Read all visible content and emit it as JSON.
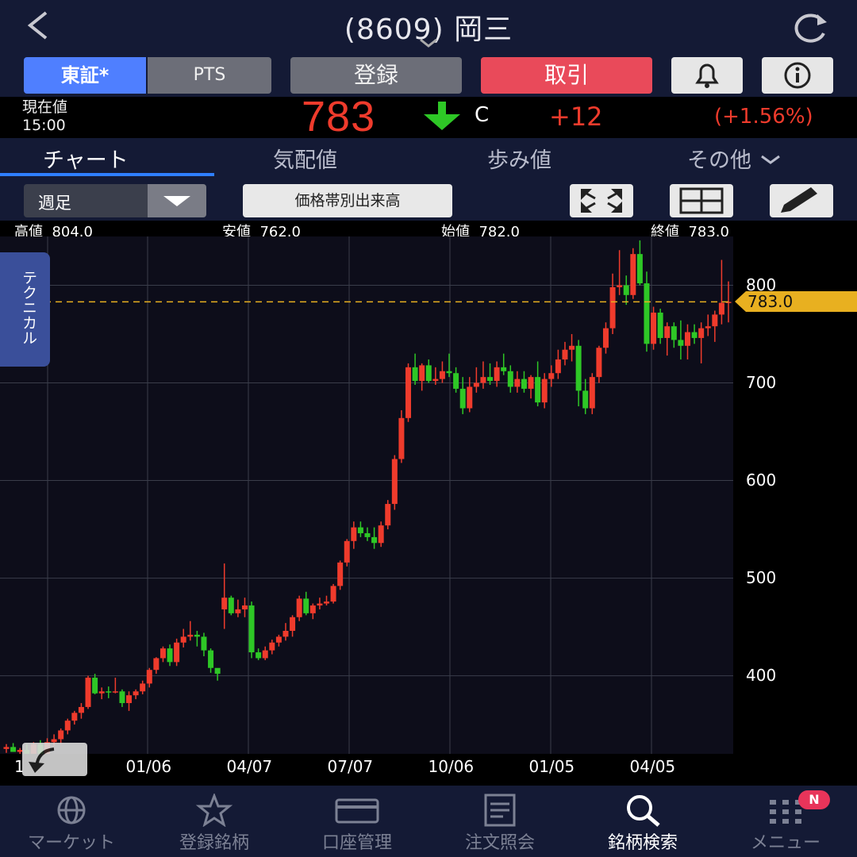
{
  "header": {
    "title": "(8609) 岡三",
    "back_icon": "chevron-left-icon",
    "refresh_icon": "refresh-icon"
  },
  "buttons": {
    "tse": "東証*",
    "pts": "PTS",
    "register": "登録",
    "trade": "取引",
    "bell_icon": "bell-icon",
    "info_icon": "info-icon"
  },
  "price": {
    "label": "現在値",
    "time": "15:00",
    "value": "783",
    "flag": "C",
    "change": "+12",
    "change_pct": "(+1.56%)",
    "direction": "down",
    "color_up": "#ef3b2c",
    "color_down": "#2ec726"
  },
  "info_tabs": {
    "chart": "チャート",
    "board": "気配値",
    "ticks": "歩み値",
    "other": "その他",
    "active": "chart"
  },
  "controls": {
    "period": "週足",
    "volume_profile": "価格帯別出来高",
    "icons": [
      "expand-icon",
      "grid-icon",
      "pencil-icon"
    ]
  },
  "ohlc": {
    "high_label": "高値",
    "high": "804.0",
    "low_label": "安値",
    "low": "762.0",
    "open_label": "始値",
    "open": "782.0",
    "close_label": "終値",
    "close": "783.0"
  },
  "technical_tab": "テクニカル",
  "last_price_label": "783.0",
  "chart_data": {
    "type": "candlestick",
    "y_ticks": [
      "800",
      "700",
      "600",
      "500",
      "400"
    ],
    "x_ticks": [
      "1",
      "01/06",
      "04/07",
      "07/07",
      "10/06",
      "01/05",
      "04/05"
    ],
    "ylim": [
      320,
      850
    ],
    "last_price": 783,
    "colors": {
      "up": "#ef3b2c",
      "down": "#2ec726",
      "grid": "#3a3d4a",
      "last_line": "#e8b020"
    },
    "candles": [
      {
        "o": 325,
        "h": 330,
        "l": 321,
        "c": 327
      },
      {
        "o": 327,
        "h": 331,
        "l": 322,
        "c": 322
      },
      {
        "o": 322,
        "h": 326,
        "l": 314,
        "c": 324
      },
      {
        "o": 324,
        "h": 330,
        "l": 318,
        "c": 320
      },
      {
        "o": 320,
        "h": 332,
        "l": 318,
        "c": 330
      },
      {
        "o": 330,
        "h": 334,
        "l": 318,
        "c": 320
      },
      {
        "o": 320,
        "h": 336,
        "l": 316,
        "c": 332
      },
      {
        "o": 332,
        "h": 340,
        "l": 328,
        "c": 335
      },
      {
        "o": 335,
        "h": 346,
        "l": 330,
        "c": 344
      },
      {
        "o": 344,
        "h": 356,
        "l": 340,
        "c": 354
      },
      {
        "o": 354,
        "h": 364,
        "l": 350,
        "c": 362
      },
      {
        "o": 362,
        "h": 372,
        "l": 356,
        "c": 368
      },
      {
        "o": 368,
        "h": 400,
        "l": 366,
        "c": 398
      },
      {
        "o": 398,
        "h": 402,
        "l": 381,
        "c": 382
      },
      {
        "o": 382,
        "h": 388,
        "l": 376,
        "c": 384
      },
      {
        "o": 384,
        "h": 389,
        "l": 377,
        "c": 383
      },
      {
        "o": 383,
        "h": 398,
        "l": 382,
        "c": 384
      },
      {
        "o": 384,
        "h": 386,
        "l": 368,
        "c": 372
      },
      {
        "o": 372,
        "h": 384,
        "l": 364,
        "c": 380
      },
      {
        "o": 380,
        "h": 386,
        "l": 376,
        "c": 384
      },
      {
        "o": 384,
        "h": 395,
        "l": 381,
        "c": 392
      },
      {
        "o": 392,
        "h": 408,
        "l": 388,
        "c": 406
      },
      {
        "o": 406,
        "h": 419,
        "l": 402,
        "c": 418
      },
      {
        "o": 418,
        "h": 430,
        "l": 414,
        "c": 428
      },
      {
        "o": 428,
        "h": 432,
        "l": 410,
        "c": 414
      },
      {
        "o": 414,
        "h": 438,
        "l": 410,
        "c": 434
      },
      {
        "o": 434,
        "h": 448,
        "l": 429,
        "c": 440
      },
      {
        "o": 440,
        "h": 456,
        "l": 436,
        "c": 442
      },
      {
        "o": 442,
        "h": 446,
        "l": 430,
        "c": 440
      },
      {
        "o": 440,
        "h": 444,
        "l": 420,
        "c": 426
      },
      {
        "o": 426,
        "h": 428,
        "l": 403,
        "c": 408
      },
      {
        "o": 408,
        "h": 406,
        "l": 395,
        "c": 402
      },
      {
        "o": 468,
        "h": 515,
        "l": 448,
        "c": 480
      },
      {
        "o": 480,
        "h": 482,
        "l": 462,
        "c": 464
      },
      {
        "o": 464,
        "h": 478,
        "l": 460,
        "c": 468
      },
      {
        "o": 468,
        "h": 480,
        "l": 460,
        "c": 472
      },
      {
        "o": 472,
        "h": 476,
        "l": 418,
        "c": 424
      },
      {
        "o": 424,
        "h": 428,
        "l": 416,
        "c": 418
      },
      {
        "o": 418,
        "h": 430,
        "l": 416,
        "c": 426
      },
      {
        "o": 426,
        "h": 437,
        "l": 422,
        "c": 434
      },
      {
        "o": 434,
        "h": 442,
        "l": 430,
        "c": 440
      },
      {
        "o": 440,
        "h": 454,
        "l": 436,
        "c": 446
      },
      {
        "o": 446,
        "h": 462,
        "l": 440,
        "c": 460
      },
      {
        "o": 460,
        "h": 482,
        "l": 456,
        "c": 479
      },
      {
        "o": 479,
        "h": 486,
        "l": 462,
        "c": 464
      },
      {
        "o": 464,
        "h": 474,
        "l": 458,
        "c": 472
      },
      {
        "o": 472,
        "h": 480,
        "l": 468,
        "c": 474
      },
      {
        "o": 474,
        "h": 482,
        "l": 472,
        "c": 476
      },
      {
        "o": 476,
        "h": 494,
        "l": 474,
        "c": 492
      },
      {
        "o": 492,
        "h": 518,
        "l": 488,
        "c": 516
      },
      {
        "o": 516,
        "h": 540,
        "l": 512,
        "c": 538
      },
      {
        "o": 538,
        "h": 558,
        "l": 530,
        "c": 552
      },
      {
        "o": 552,
        "h": 558,
        "l": 542,
        "c": 546
      },
      {
        "o": 546,
        "h": 552,
        "l": 538,
        "c": 542
      },
      {
        "o": 542,
        "h": 552,
        "l": 530,
        "c": 536
      },
      {
        "o": 536,
        "h": 558,
        "l": 532,
        "c": 554
      },
      {
        "o": 554,
        "h": 580,
        "l": 550,
        "c": 576
      },
      {
        "o": 576,
        "h": 626,
        "l": 570,
        "c": 622
      },
      {
        "o": 622,
        "h": 672,
        "l": 618,
        "c": 664
      },
      {
        "o": 664,
        "h": 720,
        "l": 660,
        "c": 716
      },
      {
        "o": 716,
        "h": 730,
        "l": 698,
        "c": 702
      },
      {
        "o": 702,
        "h": 720,
        "l": 692,
        "c": 718
      },
      {
        "o": 718,
        "h": 724,
        "l": 700,
        "c": 702
      },
      {
        "o": 702,
        "h": 716,
        "l": 698,
        "c": 704
      },
      {
        "o": 704,
        "h": 722,
        "l": 700,
        "c": 712
      },
      {
        "o": 712,
        "h": 730,
        "l": 706,
        "c": 710
      },
      {
        "o": 710,
        "h": 716,
        "l": 690,
        "c": 694
      },
      {
        "o": 694,
        "h": 706,
        "l": 668,
        "c": 674
      },
      {
        "o": 674,
        "h": 706,
        "l": 670,
        "c": 696
      },
      {
        "o": 696,
        "h": 716,
        "l": 690,
        "c": 700
      },
      {
        "o": 700,
        "h": 722,
        "l": 694,
        "c": 706
      },
      {
        "o": 706,
        "h": 720,
        "l": 698,
        "c": 702
      },
      {
        "o": 702,
        "h": 722,
        "l": 696,
        "c": 716
      },
      {
        "o": 716,
        "h": 730,
        "l": 708,
        "c": 712
      },
      {
        "o": 712,
        "h": 718,
        "l": 690,
        "c": 696
      },
      {
        "o": 696,
        "h": 712,
        "l": 690,
        "c": 704
      },
      {
        "o": 704,
        "h": 712,
        "l": 690,
        "c": 694
      },
      {
        "o": 694,
        "h": 708,
        "l": 684,
        "c": 706
      },
      {
        "o": 706,
        "h": 722,
        "l": 676,
        "c": 680
      },
      {
        "o": 680,
        "h": 710,
        "l": 674,
        "c": 704
      },
      {
        "o": 704,
        "h": 718,
        "l": 696,
        "c": 710
      },
      {
        "o": 710,
        "h": 734,
        "l": 704,
        "c": 724
      },
      {
        "o": 724,
        "h": 742,
        "l": 718,
        "c": 734
      },
      {
        "o": 734,
        "h": 750,
        "l": 722,
        "c": 738
      },
      {
        "o": 738,
        "h": 744,
        "l": 676,
        "c": 692
      },
      {
        "o": 692,
        "h": 704,
        "l": 668,
        "c": 674
      },
      {
        "o": 674,
        "h": 710,
        "l": 668,
        "c": 706
      },
      {
        "o": 706,
        "h": 738,
        "l": 700,
        "c": 736
      },
      {
        "o": 736,
        "h": 762,
        "l": 730,
        "c": 756
      },
      {
        "o": 756,
        "h": 812,
        "l": 750,
        "c": 798
      },
      {
        "o": 798,
        "h": 836,
        "l": 790,
        "c": 800
      },
      {
        "o": 800,
        "h": 810,
        "l": 780,
        "c": 790
      },
      {
        "o": 790,
        "h": 838,
        "l": 786,
        "c": 832
      },
      {
        "o": 832,
        "h": 846,
        "l": 800,
        "c": 802
      },
      {
        "o": 802,
        "h": 814,
        "l": 732,
        "c": 740
      },
      {
        "o": 740,
        "h": 778,
        "l": 734,
        "c": 772
      },
      {
        "o": 772,
        "h": 776,
        "l": 740,
        "c": 746
      },
      {
        "o": 746,
        "h": 762,
        "l": 728,
        "c": 758
      },
      {
        "o": 758,
        "h": 762,
        "l": 736,
        "c": 744
      },
      {
        "o": 744,
        "h": 764,
        "l": 724,
        "c": 738
      },
      {
        "o": 738,
        "h": 760,
        "l": 724,
        "c": 752
      },
      {
        "o": 752,
        "h": 760,
        "l": 740,
        "c": 746
      },
      {
        "o": 746,
        "h": 762,
        "l": 720,
        "c": 756
      },
      {
        "o": 756,
        "h": 770,
        "l": 748,
        "c": 758
      },
      {
        "o": 758,
        "h": 774,
        "l": 742,
        "c": 770
      },
      {
        "o": 770,
        "h": 826,
        "l": 760,
        "c": 782
      },
      {
        "o": 782,
        "h": 804,
        "l": 762,
        "c": 783
      }
    ]
  },
  "bottom_nav": [
    {
      "label": "マーケット",
      "icon": "globe-icon"
    },
    {
      "label": "登録銘柄",
      "icon": "star-icon"
    },
    {
      "label": "口座管理",
      "icon": "card-icon"
    },
    {
      "label": "注文照会",
      "icon": "document-icon"
    },
    {
      "label": "銘柄検索",
      "icon": "search-icon",
      "active": true
    },
    {
      "label": "メニュー",
      "icon": "menu-grid-icon"
    }
  ],
  "nav_badge": "N"
}
